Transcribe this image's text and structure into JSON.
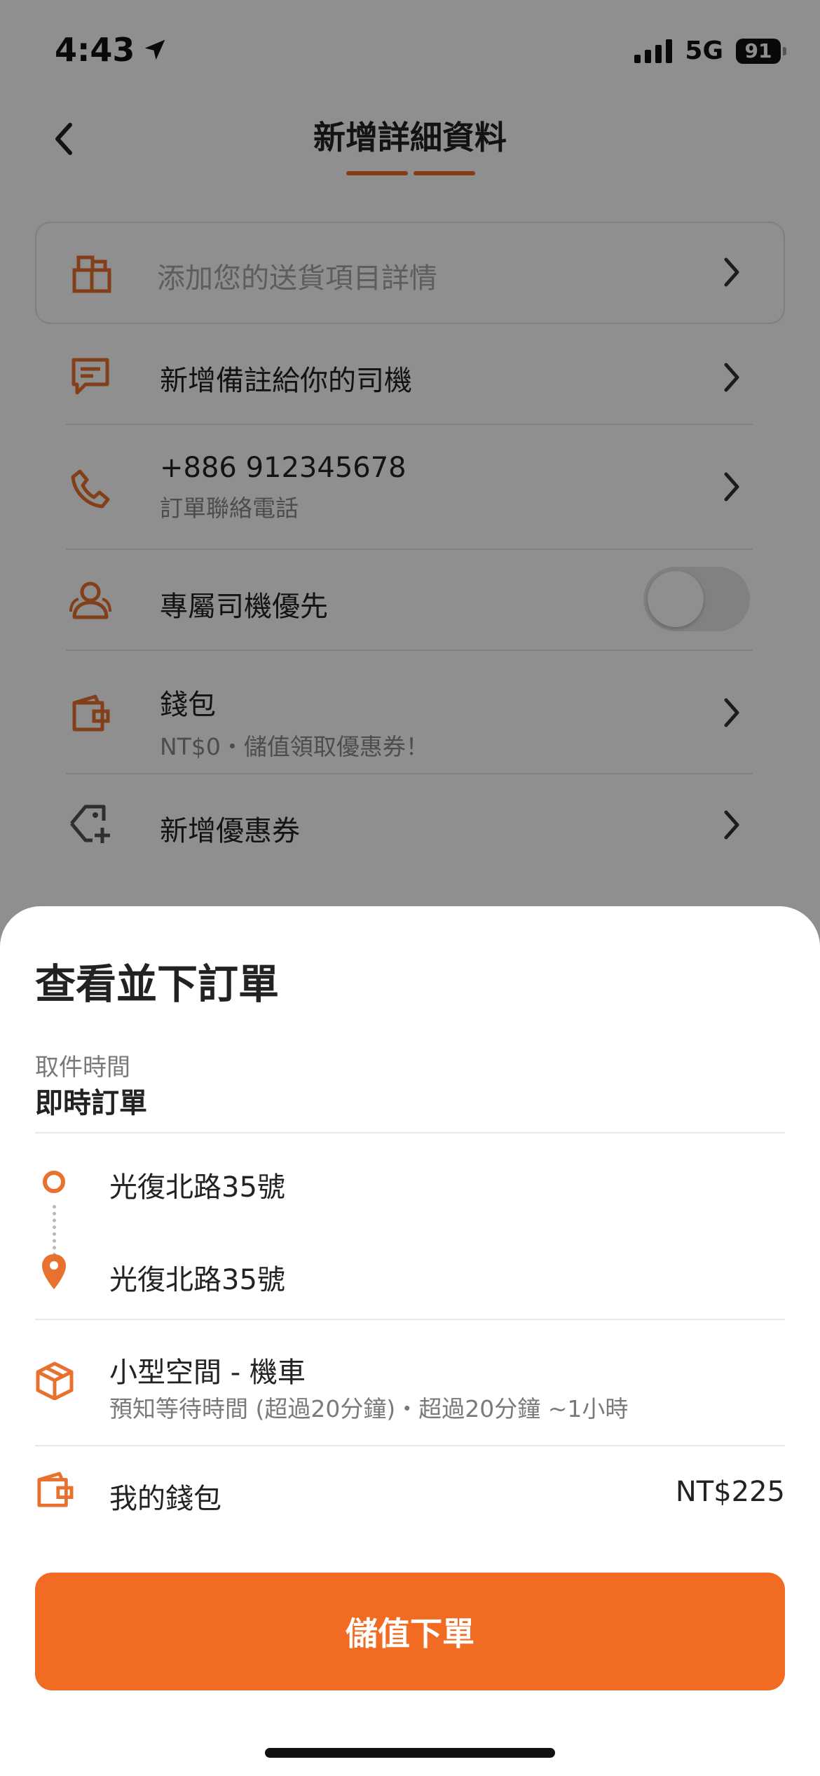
{
  "status_bar": {
    "time": "4:43",
    "network": "5G",
    "battery": "91"
  },
  "header": {
    "title": "新增詳細資料"
  },
  "details": {
    "items_placeholder": "添加您的送貨項目詳情",
    "note_label": "新增備註給你的司機",
    "phone_number": "+886 912345678",
    "phone_caption": "訂單聯絡電話",
    "preferred_driver_label": "專屬司機優先",
    "wallet_label": "錢包",
    "wallet_caption": "NT$0・儲值領取優惠券！",
    "coupon_label": "新增優惠券"
  },
  "sheet": {
    "title": "查看並下訂單",
    "pickup_time_label": "取件時間",
    "pickup_time_value": "即時訂單",
    "pickup_address": "光復北路35號",
    "dropoff_address": "光復北路35號",
    "vehicle_name": "小型空間 - 機車",
    "vehicle_wait": "預知等待時間 (超過20分鐘)・超過20分鐘 ~1小時",
    "wallet_label": "我的錢包",
    "price": "NT$225",
    "cta_label": "儲值下單"
  },
  "colors": {
    "accent": "#f26b22",
    "overlay": "rgba(0,0,0,0.44)"
  },
  "icons": [
    "location-arrow-icon",
    "back-arrow-icon",
    "package-icon",
    "chat-note-icon",
    "phone-icon",
    "driver-users-icon",
    "wallet-icon",
    "coupon-tag-icon",
    "chevron-right-icon",
    "pickup-circle-icon",
    "dropoff-pin-icon",
    "box-icon"
  ]
}
